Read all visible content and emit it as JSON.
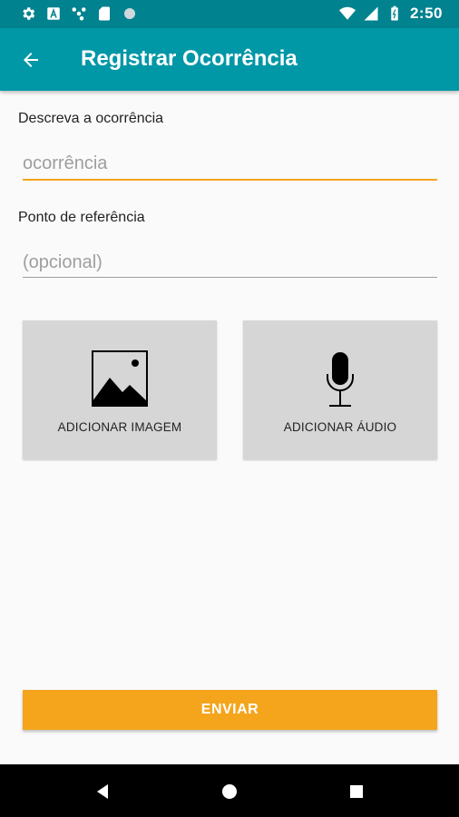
{
  "status_bar": {
    "time": "2:50",
    "icons": [
      "settings-icon",
      "text-a-icon",
      "share-icon",
      "sd-card-icon",
      "circle-icon",
      "wifi-icon",
      "signal-icon",
      "battery-icon"
    ]
  },
  "app_bar": {
    "title": "Registrar Ocorrência",
    "back_icon": "arrow-back-icon",
    "color": "#0097a7"
  },
  "form": {
    "description": {
      "label": "Descreva a ocorrência",
      "placeholder": "ocorrência",
      "value": ""
    },
    "reference": {
      "label": "Ponto de referência",
      "placeholder": "(opcional)",
      "value": ""
    }
  },
  "attachments": {
    "image": {
      "label": "ADICIONAR IMAGEM",
      "icon": "image-icon"
    },
    "audio": {
      "label": "ADICIONAR ÁUDIO",
      "icon": "microphone-icon"
    }
  },
  "actions": {
    "send_label": "ENVIAR",
    "accent": "#f4a51c"
  },
  "nav_bar": {
    "icons": [
      "nav-back-icon",
      "nav-home-icon",
      "nav-recents-icon"
    ]
  }
}
